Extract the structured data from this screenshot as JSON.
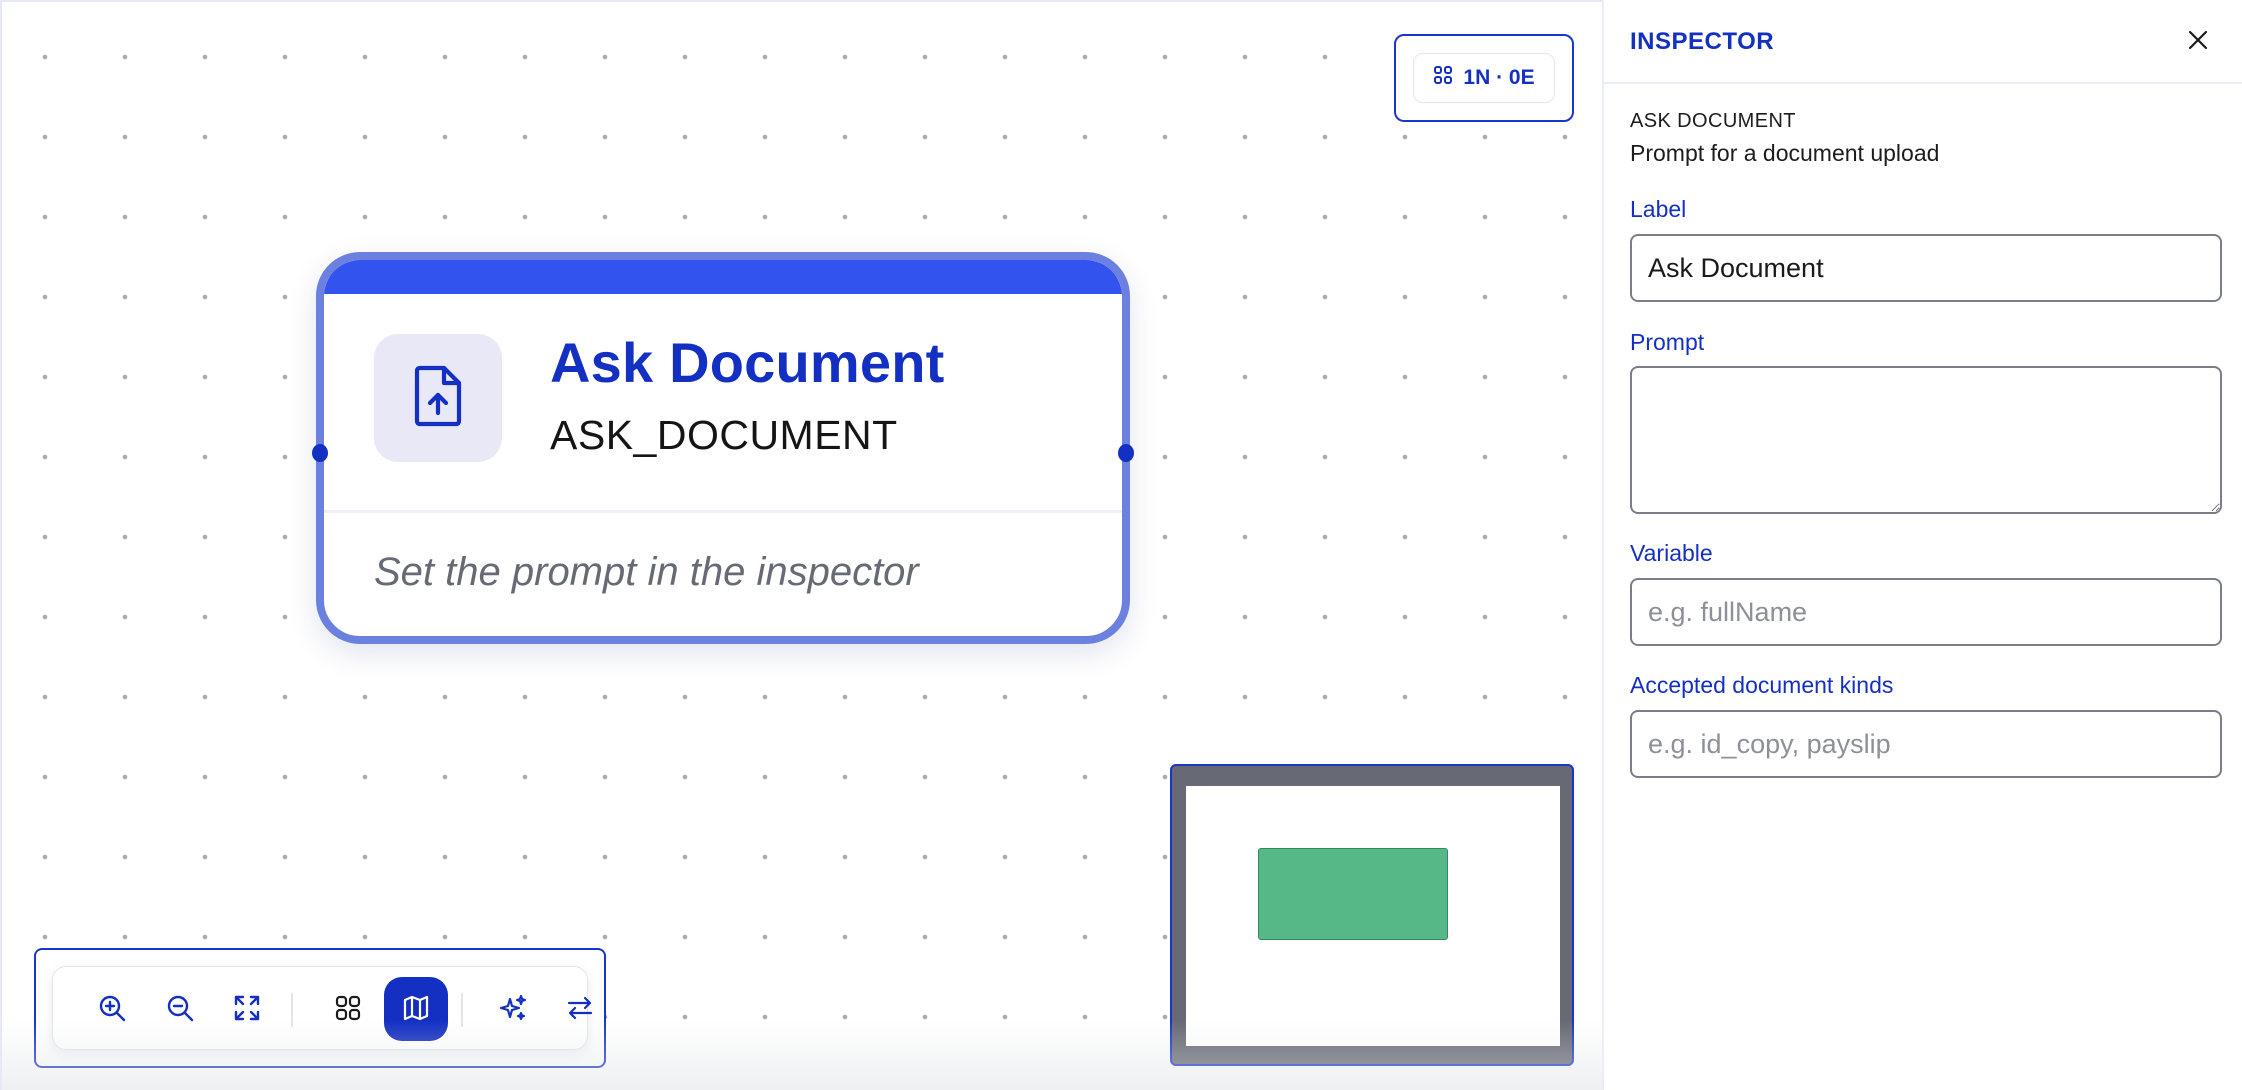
{
  "canvas": {
    "stats": {
      "text": "1N · 0E",
      "icon": "grid-icon"
    },
    "node": {
      "title": "Ask Document",
      "type": "ASK_DOCUMENT",
      "hint": "Set the prompt in the inspector",
      "icon": "file-upload-icon"
    },
    "toolbar": {
      "buttons": [
        {
          "name": "zoom-in",
          "icon": "zoom-in-icon"
        },
        {
          "name": "zoom-out",
          "icon": "zoom-out-icon"
        },
        {
          "name": "fit-view",
          "icon": "expand-icon"
        },
        {
          "name": "auto-layout",
          "icon": "grid-icon"
        },
        {
          "name": "minimap-toggle",
          "icon": "map-icon",
          "active": true
        },
        {
          "name": "magic",
          "icon": "sparkles-icon"
        },
        {
          "name": "swap-direction",
          "icon": "arrows-swap-icon"
        }
      ]
    }
  },
  "inspector": {
    "title": "INSPECTOR",
    "kind": "ASK DOCUMENT",
    "description": "Prompt for a document upload",
    "fields": {
      "label": {
        "label": "Label",
        "value": "Ask Document"
      },
      "prompt": {
        "label": "Prompt",
        "value": ""
      },
      "variable": {
        "label": "Variable",
        "placeholder": "e.g. fullName"
      },
      "accepted": {
        "label": "Accepted document kinds",
        "placeholder": "e.g. id_copy, payslip"
      }
    }
  },
  "colors": {
    "accent": "#1430c2",
    "node_border": "#6c80e0",
    "node_topbar": "#3353ee",
    "minimap_node": "#55b886"
  }
}
